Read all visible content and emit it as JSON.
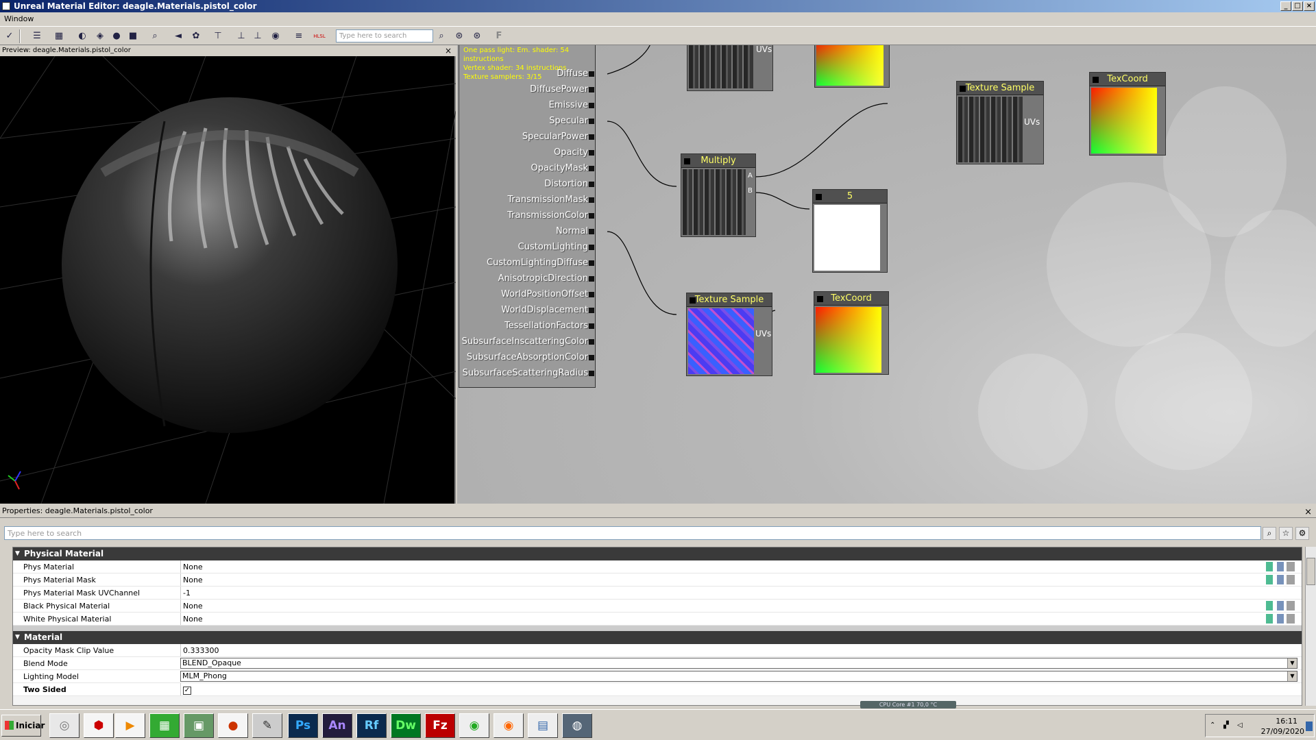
{
  "window": {
    "title": "Unreal Material Editor: deagle.Materials.pistol_color",
    "controls": {
      "minimize": "_",
      "maximize": "□",
      "close": "×"
    }
  },
  "menu": {
    "items": [
      "Window"
    ]
  },
  "toolbar": {
    "search_placeholder": "Type here to search",
    "font_button": "F",
    "hlsl_label": "HLSL"
  },
  "preview": {
    "header": "Preview: deagle.Materials.pistol_color",
    "close": "×"
  },
  "graph": {
    "stats": [
      "One pass light: Em. shader: 54 instructions",
      "Vertex shader: 34 instructions",
      "Texture samplers: 3/15"
    ],
    "material_pins": [
      "Diffuse",
      "DiffusePower",
      "Emissive",
      "Specular",
      "SpecularPower",
      "Opacity",
      "OpacityMask",
      "Distortion",
      "TransmissionMask",
      "TransmissionColor",
      "Normal",
      "CustomLighting",
      "CustomLightingDiffuse",
      "AnisotropicDirection",
      "WorldPositionOffset",
      "WorldDisplacement",
      "TessellationFactors",
      "SubsurfaceInscatteringColor",
      "SubsurfaceAbsorptionColor",
      "SubsurfaceScatteringRadius"
    ],
    "nodes": {
      "multiply": {
        "title": "Multiply",
        "pin_a": "A",
        "pin_b": "B"
      },
      "constant": {
        "title": "5"
      },
      "texsample_top": {
        "title": "Texture Sample",
        "uvs": "UVs"
      },
      "texcoord_top": {
        "title": "TexCoord"
      },
      "texsample_bottom": {
        "title": "Texture Sample",
        "uvs": "UVs"
      },
      "texcoord_bottom": {
        "title": "TexCoord"
      },
      "partial_texsample": {
        "uvs": "UVs"
      }
    }
  },
  "properties": {
    "header": "Properties: deagle.Materials.pistol_color",
    "close": "×",
    "search_placeholder": "Type here to search",
    "categories": [
      {
        "name": "Physical Material",
        "rows": [
          {
            "name": "Phys Material",
            "value": "None"
          },
          {
            "name": "Phys Material Mask",
            "value": "None"
          },
          {
            "name": "Phys Material Mask UVChannel",
            "value": "-1"
          },
          {
            "name": "Black Physical Material",
            "value": "None"
          },
          {
            "name": "White Physical Material",
            "value": "None"
          }
        ]
      },
      {
        "name": "Material",
        "rows": [
          {
            "name": "Opacity Mask Clip Value",
            "value": "0.333300"
          },
          {
            "name": "Blend Mode",
            "value": "BLEND_Opaque"
          },
          {
            "name": "Lighting Model",
            "value": "MLM_Phong"
          },
          {
            "name": "Two Sided",
            "value": "✓"
          }
        ]
      }
    ]
  },
  "status": {
    "cpu": "CPU Core #1    70,0 °C"
  },
  "taskbar": {
    "start_label": "Iniciar",
    "apps": [
      "◎",
      "⬢",
      "▶",
      "▦",
      "▣",
      "●",
      "✎",
      "Ps",
      "An",
      "Rf",
      "Dw",
      "Fz",
      "◉",
      "◉",
      "▤",
      "◍"
    ],
    "time": "16:11",
    "date": "27/09/2020"
  }
}
